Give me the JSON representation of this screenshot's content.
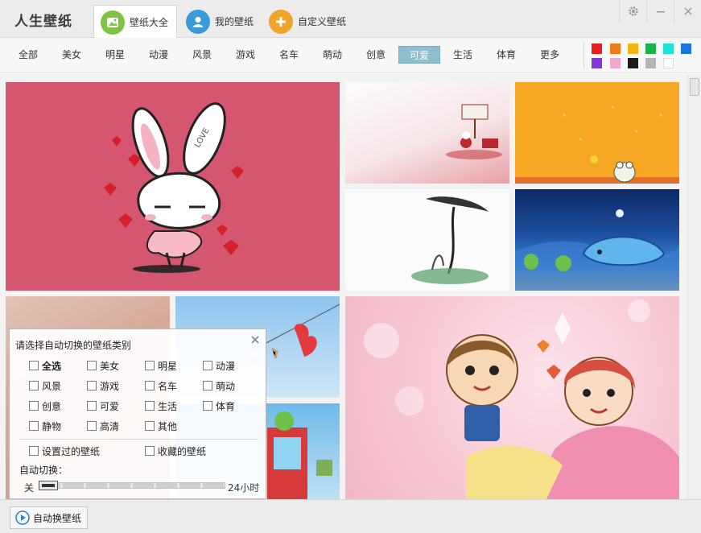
{
  "app": {
    "title": "人生壁纸"
  },
  "tabs": [
    {
      "label": "壁纸大全",
      "active": true,
      "color": "#7cc443"
    },
    {
      "label": "我的壁纸",
      "active": false,
      "color": "#3c9ad8"
    },
    {
      "label": "自定义壁纸",
      "active": false,
      "color": "#f0a52a"
    }
  ],
  "window_controls": [
    "settings-icon",
    "minimize-icon",
    "close-icon"
  ],
  "categories": [
    {
      "label": "全部",
      "active": false
    },
    {
      "label": "美女",
      "active": false
    },
    {
      "label": "明星",
      "active": false
    },
    {
      "label": "动漫",
      "active": false
    },
    {
      "label": "风景",
      "active": false
    },
    {
      "label": "游戏",
      "active": false
    },
    {
      "label": "名车",
      "active": false
    },
    {
      "label": "萌动",
      "active": false
    },
    {
      "label": "创意",
      "active": false
    },
    {
      "label": "可爱",
      "active": true
    },
    {
      "label": "生活",
      "active": false
    },
    {
      "label": "体育",
      "active": false
    },
    {
      "label": "更多",
      "active": false
    }
  ],
  "color_swatches": [
    "#e51e1e",
    "#f07d1a",
    "#f2b516",
    "#19b34a",
    "#1ee3d9",
    "#1b74e0",
    "#7f3ad6",
    "#f2a7cf",
    "#1a1a1a",
    "#b5b5b5",
    "#ffffff"
  ],
  "auto_switch_popup": {
    "title": "请选择自动切换的壁纸类别",
    "options": [
      {
        "label": "全选",
        "checked": false,
        "bold": true
      },
      {
        "label": "美女",
        "checked": false
      },
      {
        "label": "明星",
        "checked": false
      },
      {
        "label": "动漫",
        "checked": false
      },
      {
        "label": "风景",
        "checked": false
      },
      {
        "label": "游戏",
        "checked": false
      },
      {
        "label": "名车",
        "checked": false
      },
      {
        "label": "萌动",
        "checked": false
      },
      {
        "label": "创意",
        "checked": false
      },
      {
        "label": "可爱",
        "checked": false
      },
      {
        "label": "生活",
        "checked": false
      },
      {
        "label": "体育",
        "checked": false
      },
      {
        "label": "静物",
        "checked": false
      },
      {
        "label": "高清",
        "checked": false
      },
      {
        "label": "其他",
        "checked": false
      }
    ],
    "extra_options": [
      {
        "label": "设置过的壁纸",
        "checked": false
      },
      {
        "label": "收藏的壁纸",
        "checked": false
      }
    ],
    "auto_switch_label": "自动切换：",
    "slider_min_label": "关",
    "slider_max_label": "24小时",
    "slider_value": 0
  },
  "bottom": {
    "auto_button_label": "自动换壁纸"
  }
}
